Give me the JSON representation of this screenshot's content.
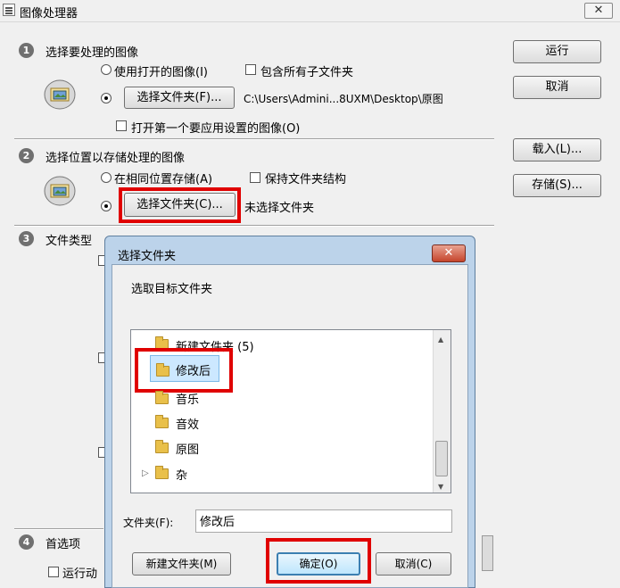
{
  "window": {
    "title": "图像处理器",
    "close_label": "✕"
  },
  "section1": {
    "number": "1",
    "title": "选择要处理的图像",
    "radio_open_label": "使用打开的图像(I)",
    "include_subfolders_label": "包含所有子文件夹",
    "select_folder_button": "选择文件夹(F)...",
    "folder_path": "C:\\Users\\Admini...8UXM\\Desktop\\原图",
    "open_first_label": "打开第一个要应用设置的图像(O)"
  },
  "section2": {
    "number": "2",
    "title": "选择位置以存储处理的图像",
    "radio_same_label": "在相同位置存储(A)",
    "keep_structure_label": "保持文件夹结构",
    "select_folder_button": "选择文件夹(C)...",
    "no_folder_text": "未选择文件夹"
  },
  "section3": {
    "number": "3",
    "title": "文件类型"
  },
  "section4": {
    "number": "4",
    "title": "首选项",
    "run_action_label": "运行动"
  },
  "right_buttons": {
    "run": "运行",
    "cancel": "取消",
    "load": "载入(L)...",
    "save": "存储(S)..."
  },
  "dialog": {
    "title": "选择文件夹",
    "close_label": "✕",
    "prompt": "选取目标文件夹",
    "tree_items": [
      {
        "label": "新建文件夹 (5)",
        "selected": false,
        "expandable": false
      },
      {
        "label": "修改后",
        "selected": true,
        "expandable": false
      },
      {
        "label": "音乐",
        "selected": false,
        "expandable": false
      },
      {
        "label": "音效",
        "selected": false,
        "expandable": false
      },
      {
        "label": "原图",
        "selected": false,
        "expandable": false
      },
      {
        "label": "杂",
        "selected": false,
        "expandable": true
      }
    ],
    "folder_field_label": "文件夹(F):",
    "folder_field_value": "修改后",
    "new_folder_button": "新建文件夹(M)",
    "ok_button": "确定(O)",
    "cancel_button": "取消(C)"
  },
  "colors": {
    "highlight_red": "#e00000",
    "dialog_frame": "#bcd3ea",
    "selection": "#cce8ff"
  }
}
